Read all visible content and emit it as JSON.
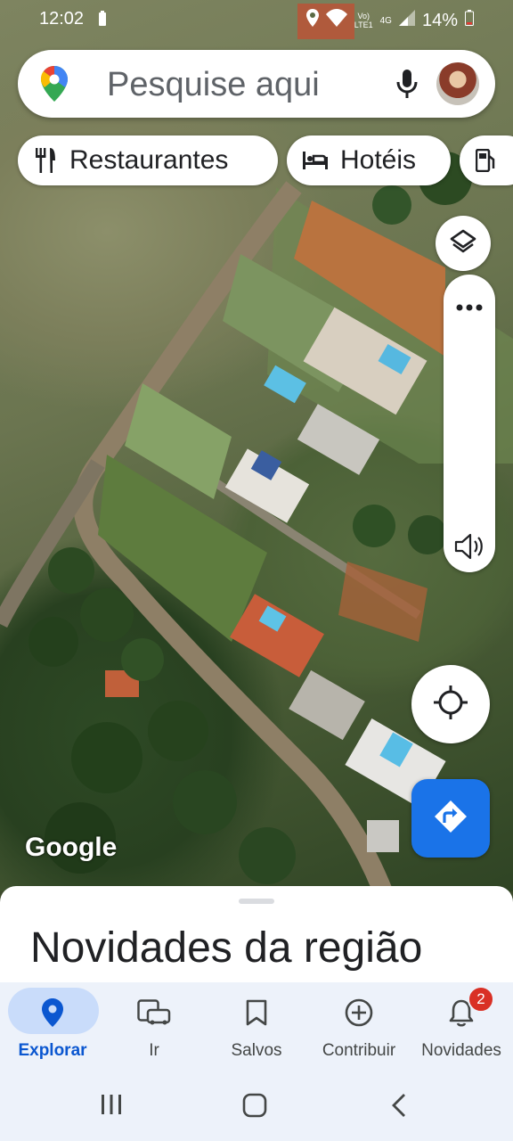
{
  "status_bar": {
    "time": "12:02",
    "network_label_top": "Vo)",
    "network_label_bottom": "LTE1",
    "network_type": "4G",
    "battery": "14%"
  },
  "search": {
    "placeholder": "Pesquise aqui"
  },
  "chips": [
    {
      "label": "Restaurantes",
      "icon": "restaurant-icon"
    },
    {
      "label": "Hotéis",
      "icon": "hotel-icon"
    },
    {
      "label": "",
      "icon": "gas-station-icon"
    }
  ],
  "map": {
    "attribution": "Google"
  },
  "sheet": {
    "title": "Novidades da região"
  },
  "nav": {
    "items": [
      {
        "label": "Explorar",
        "icon": "explore-pin-icon",
        "active": true
      },
      {
        "label": "Ir",
        "icon": "commute-icon"
      },
      {
        "label": "Salvos",
        "icon": "bookmark-icon"
      },
      {
        "label": "Contribuir",
        "icon": "add-circle-icon"
      },
      {
        "label": "Novidades",
        "icon": "bell-icon",
        "badge": "2"
      }
    ]
  },
  "colors": {
    "accent": "#1a73e8",
    "active_pill": "#c9dcfa",
    "badge": "#d93025"
  }
}
